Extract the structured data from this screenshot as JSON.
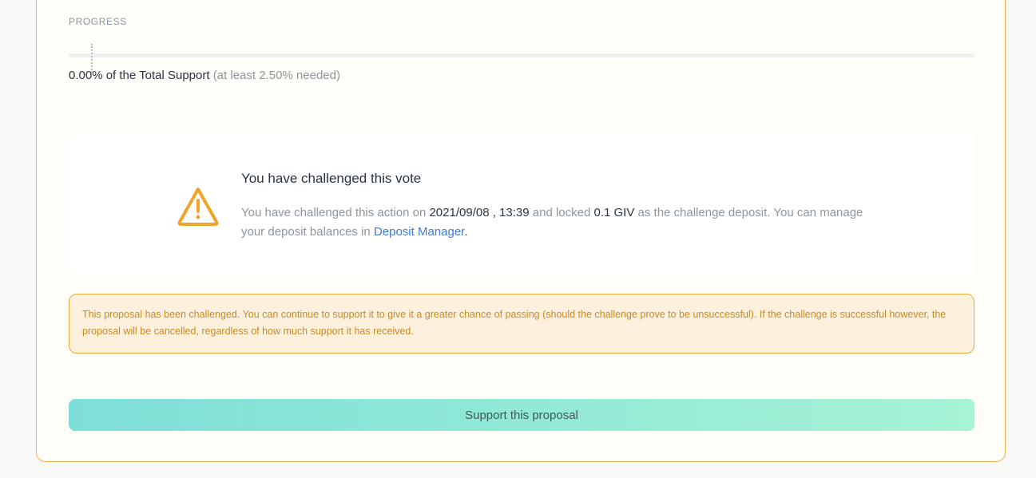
{
  "progress": {
    "label": "PROGRESS",
    "percent_value": 0.0,
    "required_value": 2.5,
    "percent_text": "0.00% of the Total Support",
    "needed_text": "(at least 2.50% needed)"
  },
  "challenge": {
    "title": "You have challenged this vote",
    "body_prefix": "You have challenged this action on ",
    "date": "2021/09/08 , 13:39",
    "body_middle": " and locked ",
    "amount": "0.1 GIV",
    "body_suffix": " as the challenge deposit. You can manage your deposit balances in ",
    "link_text": "Deposit Manager",
    "body_end": "."
  },
  "notice": {
    "text": "This proposal has been challenged. You can continue to support it to give it a greater chance of passing (should the challenge prove to be unsuccessful). If the challenge is successful however, the proposal will be cancelled, regardless of how much support it has received."
  },
  "actions": {
    "support_label": "Support this proposal"
  },
  "colors": {
    "accent_warning": "#f0a42c",
    "link": "#3f7ad6",
    "panel_border": "#eab253",
    "button_gradient_start": "#7ddfd7",
    "button_gradient_end": "#a6f3d5"
  },
  "icons": {
    "challenge_icon": "warning-triangle-icon"
  }
}
